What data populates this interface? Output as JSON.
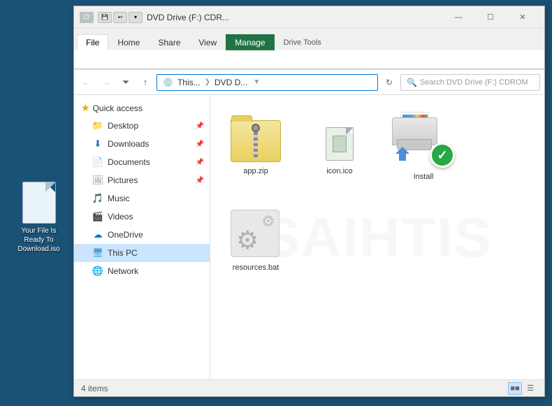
{
  "desktop": {
    "icon_label": "Your File Is Ready To Download.iso"
  },
  "titlebar": {
    "title": "DVD Drive (F:) CDR...",
    "quick_access_icon": "🗂",
    "minimize": "—",
    "maximize": "☐",
    "close": "✕"
  },
  "ribbon": {
    "tabs": [
      "File",
      "Home",
      "Share",
      "View",
      "Drive Tools"
    ],
    "active_tab": "Drive Tools",
    "manage_tab": "Manage"
  },
  "addressbar": {
    "path_parts": [
      "This...",
      "DVD D..."
    ],
    "search_placeholder": "Search DVD Drive (F:) CDROM"
  },
  "sidebar": {
    "quick_access_label": "Quick access",
    "items": [
      {
        "label": "Desktop",
        "type": "folder-blue"
      },
      {
        "label": "Downloads",
        "type": "downloads"
      },
      {
        "label": "Documents",
        "type": "docs"
      },
      {
        "label": "Pictures",
        "type": "pics"
      },
      {
        "label": "Music",
        "type": "music"
      },
      {
        "label": "Videos",
        "type": "videos"
      },
      {
        "label": "OneDrive",
        "type": "onedrive"
      },
      {
        "label": "This PC",
        "type": "thispc"
      },
      {
        "label": "Network",
        "type": "network"
      }
    ]
  },
  "files": [
    {
      "name": "app.zip",
      "type": "zip"
    },
    {
      "name": "icon.ico",
      "type": "ico"
    },
    {
      "name": "Install",
      "type": "install"
    },
    {
      "name": "resources.bat",
      "type": "resources"
    }
  ],
  "statusbar": {
    "count": "4 items"
  }
}
